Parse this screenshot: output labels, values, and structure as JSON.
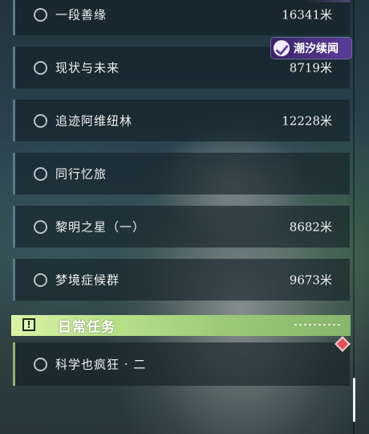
{
  "quests": [
    {
      "name": "一段善缘",
      "distance": "16341",
      "unit": "米"
    },
    {
      "name": "现状与未来",
      "distance": "8719",
      "unit": "米"
    },
    {
      "name": "追迹阿维纽林",
      "distance": "12228",
      "unit": "米"
    },
    {
      "name": "同行忆旅",
      "distance": "",
      "unit": ""
    },
    {
      "name": "黎明之星（一）",
      "distance": "8682",
      "unit": "米"
    },
    {
      "name": "梦境症候群",
      "distance": "9673",
      "unit": "米"
    }
  ],
  "daily_section": {
    "title": "日常任务",
    "icon": "exclamation-icon"
  },
  "daily_quests": [
    {
      "name": "科学也疯狂 · 二"
    }
  ],
  "watermark": {
    "text": "潮汐续闻",
    "icon": "logo-mark-icon"
  },
  "colors": {
    "section_accent": "#b9e08a",
    "tracker_marker": "#e0525a",
    "logo_bg": "#5b3c98"
  }
}
